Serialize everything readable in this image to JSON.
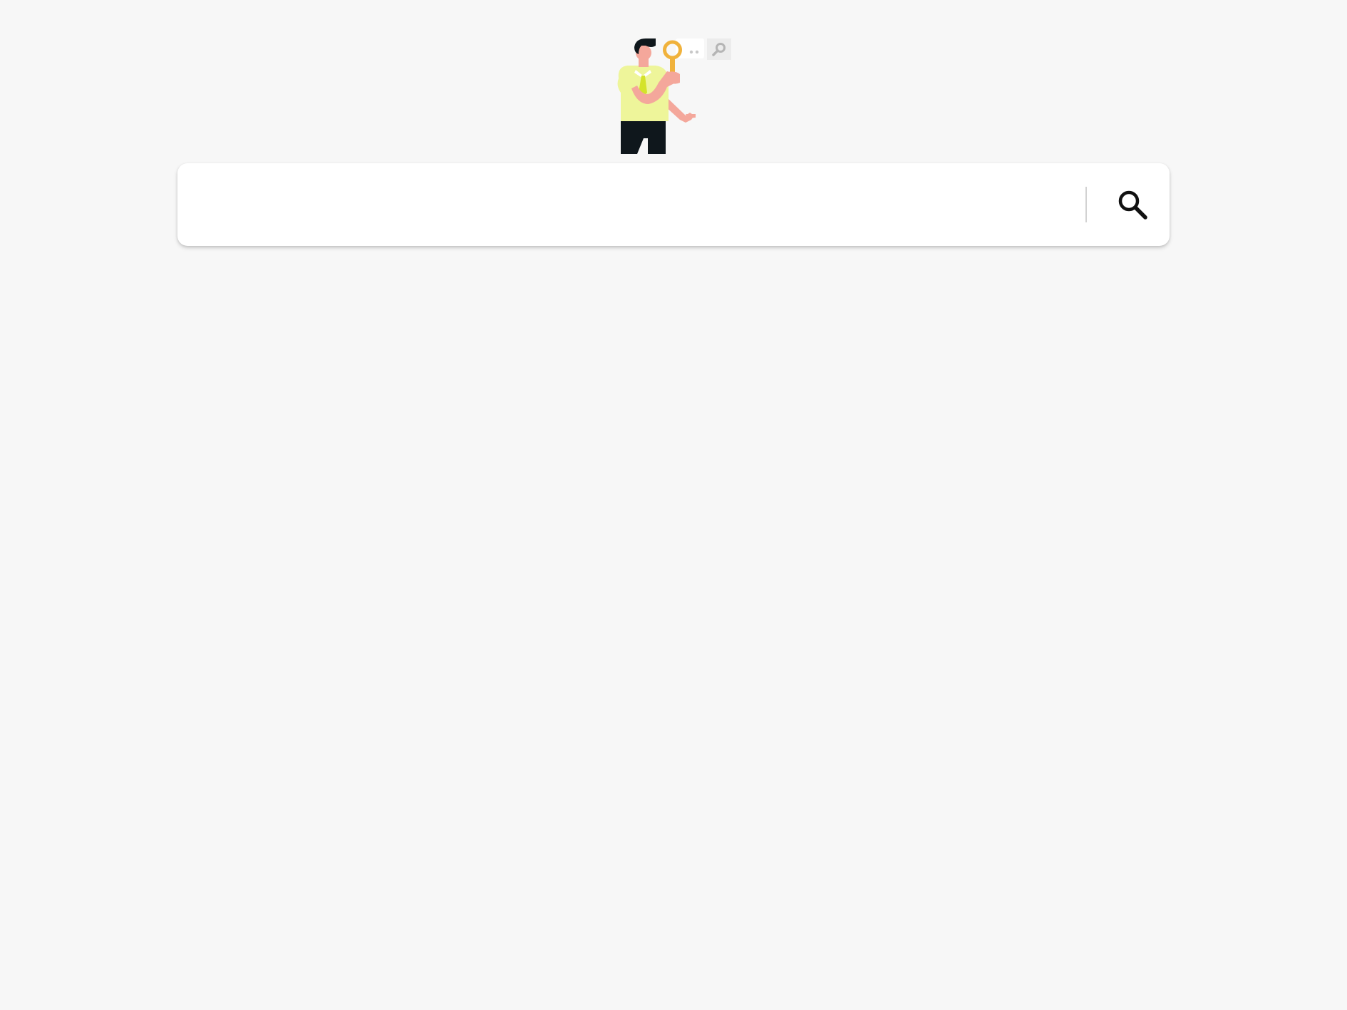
{
  "illustration": {
    "icon": "person-with-magnifier-illustration",
    "colors": {
      "shirt": "#eef59a",
      "tie": "#d4e32a",
      "skin": "#f4a79b",
      "hair": "#0f171c",
      "pants": "#0f171c",
      "magnifier": "#f0b23c",
      "bubble_dots": "#c8c8c8",
      "bubble_bg": "#ececec"
    }
  },
  "search": {
    "value": "",
    "placeholder": "",
    "button_icon": "search-icon"
  },
  "colors": {
    "background": "#f7f7f7",
    "search_bar": "#ffffff",
    "divider": "#d2d2d2",
    "icon": "#111111"
  }
}
